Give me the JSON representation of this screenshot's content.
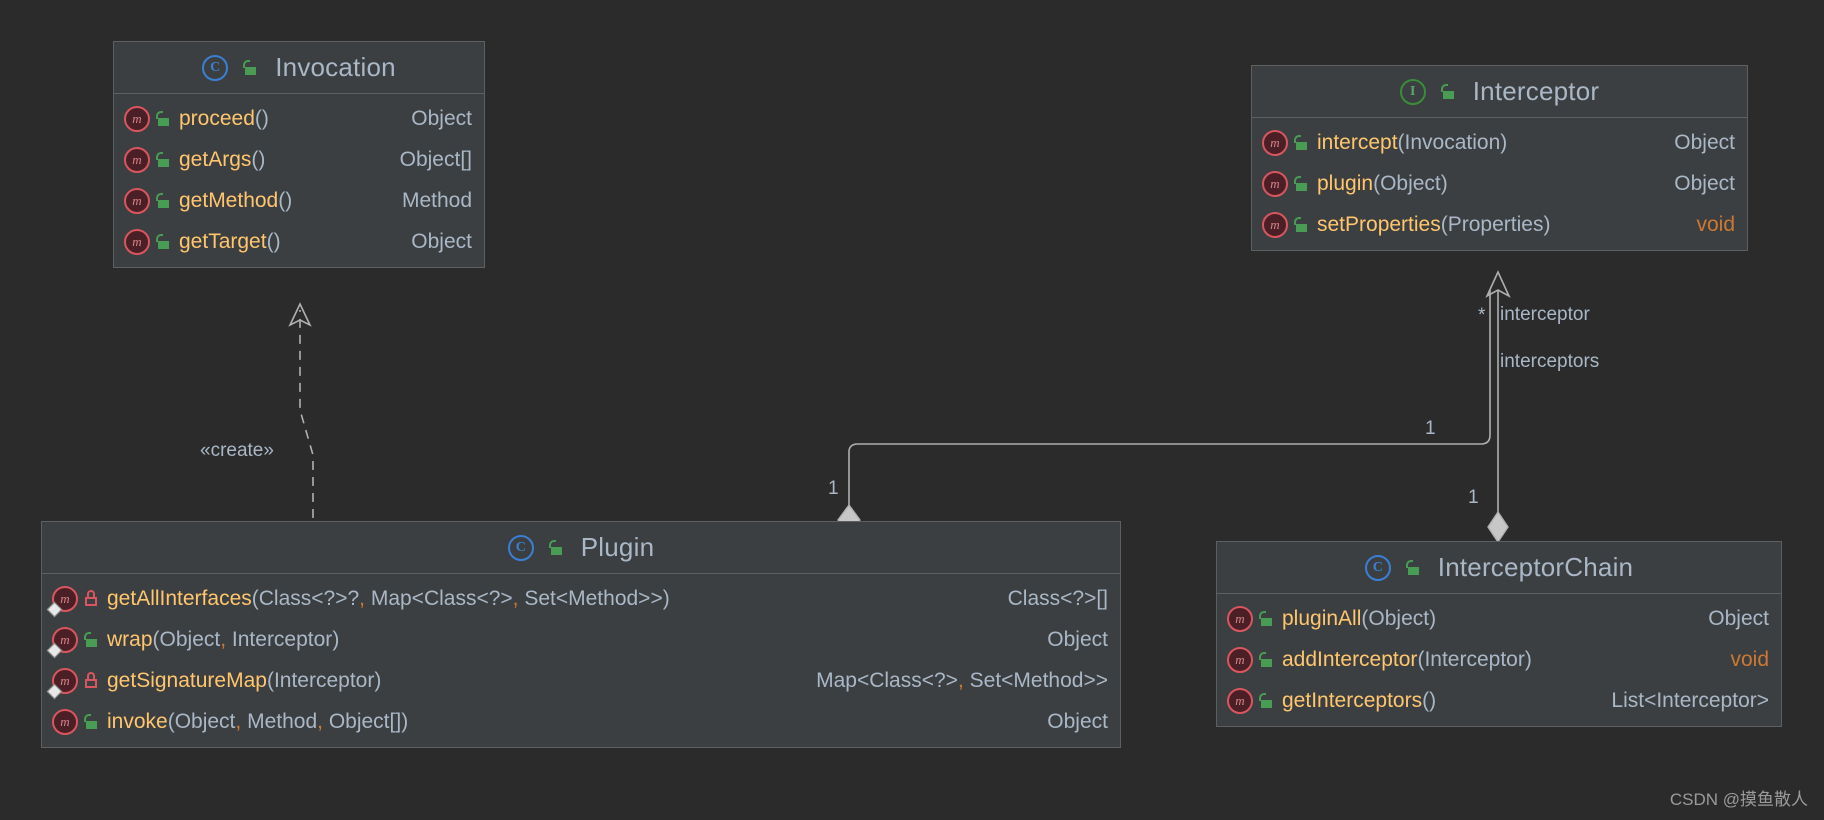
{
  "diagram": {
    "type": "uml-class-diagram",
    "theme": {
      "background": "#2b2b2b",
      "box_fill": "#3c3f41",
      "box_border": "#5e6060",
      "text": "#a9b7c6",
      "method_name": "#ffc66d",
      "keyword": "#cc7832",
      "class_icon": "#3b7fd4",
      "interface_icon": "#59a869",
      "method_icon": "#d9555f",
      "lock_public": "#499c54",
      "lock_private": "#d9555f",
      "edge": "#b0b0b0"
    }
  },
  "classes": {
    "invocation": {
      "name": "Invocation",
      "stereotype_icon": "class-icon",
      "visibility_icon": "unlocked-public-icon",
      "members": [
        {
          "icon": "method-icon",
          "lock": "public",
          "name": "proceed",
          "params": "",
          "ret": "Object",
          "ret_kw": false
        },
        {
          "icon": "method-icon",
          "lock": "public",
          "name": "getArgs",
          "params": "",
          "ret": "Object[]",
          "ret_kw": false
        },
        {
          "icon": "method-icon",
          "lock": "public",
          "name": "getMethod",
          "params": "",
          "ret": "Method",
          "ret_kw": false
        },
        {
          "icon": "method-icon",
          "lock": "public",
          "name": "getTarget",
          "params": "",
          "ret": "Object",
          "ret_kw": false
        }
      ]
    },
    "interceptor": {
      "name": "Interceptor",
      "stereotype_icon": "interface-icon",
      "visibility_icon": "unlocked-public-icon",
      "members": [
        {
          "icon": "method-icon",
          "lock": "public",
          "name": "intercept",
          "params": "Invocation",
          "ret": "Object",
          "ret_kw": false
        },
        {
          "icon": "method-icon",
          "lock": "public",
          "name": "plugin",
          "params": "Object",
          "ret": "Object",
          "ret_kw": false
        },
        {
          "icon": "method-icon",
          "lock": "public",
          "name": "setProperties",
          "params": "Properties",
          "ret": "void",
          "ret_kw": true
        }
      ]
    },
    "plugin": {
      "name": "Plugin",
      "stereotype_icon": "class-icon",
      "visibility_icon": "unlocked-public-icon",
      "members": [
        {
          "icon": "static-method-icon",
          "lock": "private",
          "name": "getAllInterfaces",
          "params": "Class<?>?, Map<Class<?>, Set<Method>>",
          "ret": "Class<?>[]",
          "ret_kw": false
        },
        {
          "icon": "static-method-icon",
          "lock": "public",
          "name": "wrap",
          "params": "Object, Interceptor",
          "ret": "Object",
          "ret_kw": false
        },
        {
          "icon": "static-method-icon",
          "lock": "private",
          "name": "getSignatureMap",
          "params": "Interceptor",
          "ret": "Map<Class<?>, Set<Method>>",
          "ret_kw": false
        },
        {
          "icon": "method-icon",
          "lock": "public",
          "name": "invoke",
          "params": "Object, Method, Object[]",
          "ret": "Object",
          "ret_kw": false
        }
      ]
    },
    "interceptor_chain": {
      "name": "InterceptorChain",
      "stereotype_icon": "class-icon",
      "visibility_icon": "unlocked-public-icon",
      "members": [
        {
          "icon": "method-icon",
          "lock": "public",
          "name": "pluginAll",
          "params": "Object",
          "ret": "Object",
          "ret_kw": false
        },
        {
          "icon": "method-icon",
          "lock": "public",
          "name": "addInterceptor",
          "params": "Interceptor",
          "ret": "void",
          "ret_kw": true
        },
        {
          "icon": "method-icon",
          "lock": "public",
          "name": "getInterceptors",
          "params": "",
          "ret": "List<Interceptor>",
          "ret_kw": false
        }
      ]
    }
  },
  "edges": {
    "create_dependency": {
      "label": "«create»",
      "style": "dashed",
      "arrow": "open-triangle",
      "from": "Plugin",
      "to": "Invocation"
    },
    "chain_to_interceptor": {
      "multiplicity_source": "*",
      "role": "interceptor",
      "role_alt": "interceptors",
      "multiplicity_target": "1",
      "arrow": "open-triangle",
      "from": "InterceptorChain",
      "to": "Interceptor"
    },
    "plugin_to_chain": {
      "multiplicity_plugin": "1",
      "multiplicity_chain": "1",
      "arrow": "aggregation-diamond",
      "from": "Plugin",
      "to": "InterceptorChain"
    }
  },
  "watermark": "CSDN @摸鱼散人"
}
